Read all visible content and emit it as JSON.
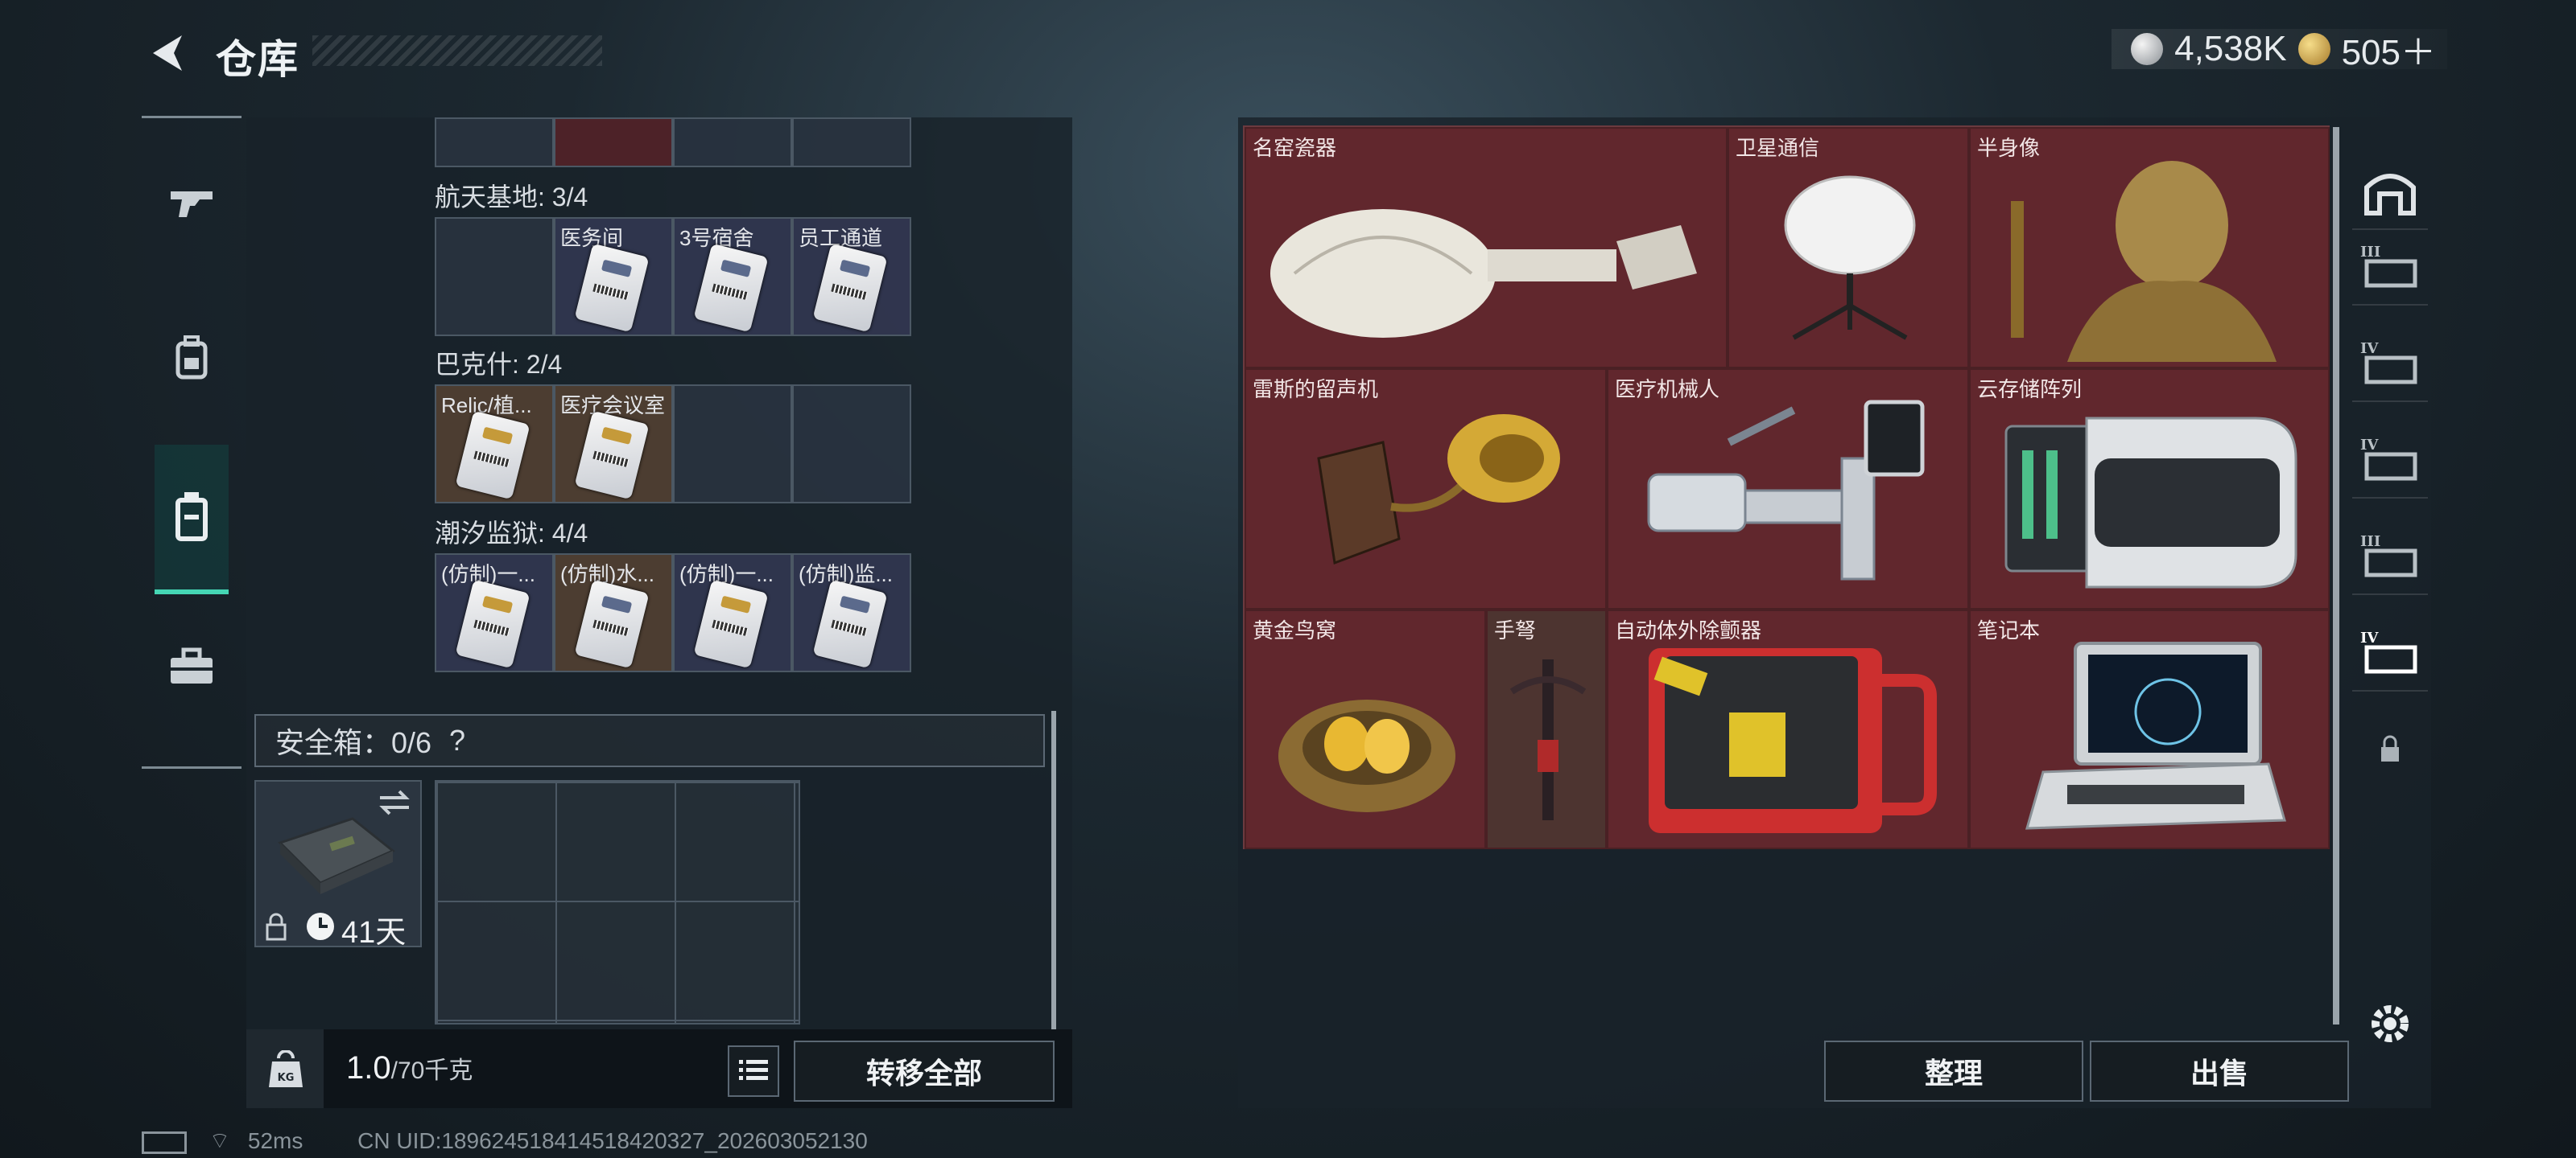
{
  "header": {
    "title": "仓库",
    "silver_amount": "4,538K",
    "gold_amount": "505＋"
  },
  "left": {
    "sections": [
      {
        "label": "航天基地: 3/4",
        "cells": [
          "",
          "医务间",
          "3号宿舍",
          "员工通道"
        ]
      },
      {
        "label": "巴克什: 2/4",
        "cells": [
          "Relic/植...",
          "医疗会议室",
          "",
          ""
        ]
      },
      {
        "label": "潮汐监狱: 4/4",
        "cells": [
          "(仿制)一...",
          "(仿制)水...",
          "(仿制)一...",
          "(仿制)监..."
        ]
      }
    ],
    "safebox_label": "安全箱：0/6",
    "safebox_help": "?",
    "safebox_timer": "41天",
    "weight_value": "1.0",
    "weight_unit": "/70千克",
    "transfer_all": "转移全部"
  },
  "right": {
    "items": [
      "名窑瓷器",
      "卫星通信",
      "半身像",
      "雷斯的留声机",
      "医疗机械人",
      "云存储阵列",
      "黄金鸟窝",
      "手弩",
      "自动体外除颤器",
      "笔记本"
    ],
    "sort_label": "整理",
    "sell_label": "出售"
  },
  "status": {
    "ping": "52ms",
    "uid": "CN UID:1896245184145184203​27_202603052130"
  }
}
